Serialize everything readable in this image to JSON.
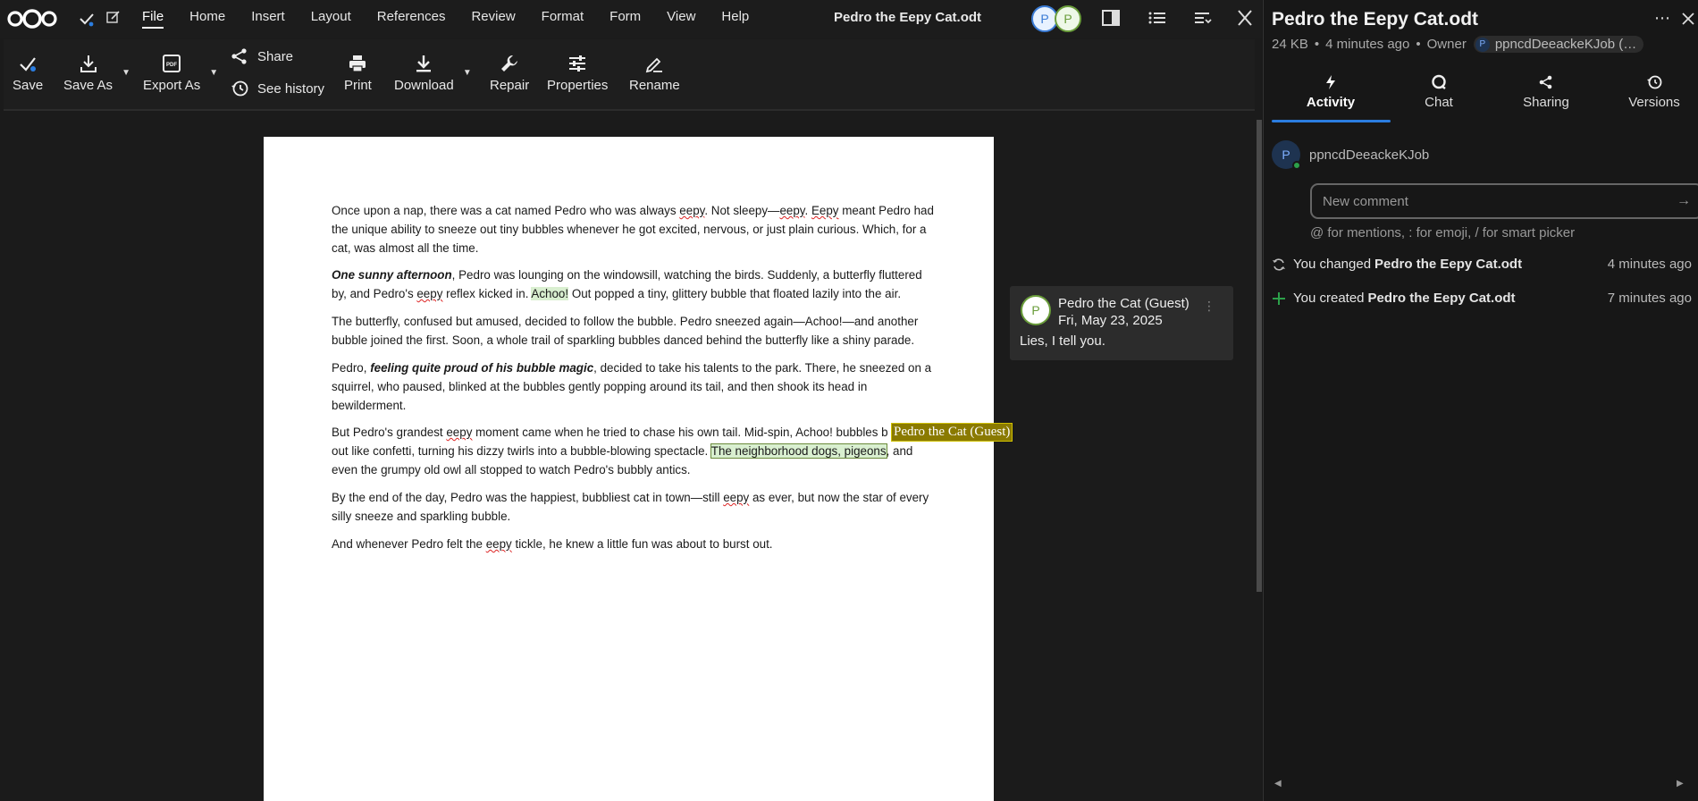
{
  "menubar": {
    "menus": [
      "File",
      "Home",
      "Insert",
      "Layout",
      "References",
      "Review",
      "Format",
      "Form",
      "View",
      "Help"
    ],
    "active_menu": "File",
    "doc_title": "Pedro the Eepy Cat.odt",
    "avatars": [
      "P",
      "P"
    ]
  },
  "toolbar": {
    "save": "Save",
    "save_as": "Save As",
    "export_as": "Export As",
    "share": "Share",
    "see_history": "See history",
    "print": "Print",
    "download": "Download",
    "repair": "Repair",
    "properties": "Properties",
    "rename": "Rename"
  },
  "document": {
    "p1_a": "Once upon a nap, there was a cat named Pedro who was always ",
    "p1_eepy1": "eepy",
    "p1_b": ". Not sleepy—",
    "p1_eepy2": "eepy",
    "p1_c": ". ",
    "p1_eepy3": "Eepy",
    "p1_d": " meant Pedro had the unique ability to sneeze out tiny bubbles whenever he got excited, nervous, or just plain curious. Which, for a cat, was almost all the time.",
    "p2_bold": "One sunny afternoon",
    "p2_a": ", Pedro was lounging on the windowsill, watching the birds. Suddenly, a butterfly fluttered by, and Pedro's ",
    "p2_eepy": "eepy",
    "p2_b": " reflex kicked in. ",
    "p2_achoo": "Achoo!",
    "p2_c": " Out popped a tiny, glittery bubble that floated lazily into the air.",
    "p3": "The butterfly, confused but amused, decided to follow the bubble. Pedro sneezed again—Achoo!—and another bubble joined the first. Soon, a whole trail of sparkling bubbles danced behind the butterfly like a shiny parade.",
    "p4_a": "Pedro, ",
    "p4_bold": "feeling quite proud of his bubble magic",
    "p4_b": ", decided to take his talents to the park. There, he sneezed on a squirrel, who paused, blinked at the bubbles gently popping around its tail, and then shook its head in bewilderment.",
    "p5_a": "But Pedro's grandest ",
    "p5_eepy": "eepy",
    "p5_b": " moment came when he tried to chase his own tail. Mid-spin, Achoo! bubbles b",
    "p5_c": "out like confetti, turning his dizzy twirls into a bubble-blowing spectacle. ",
    "p5_hl": "The neighborhood dogs, pigeons",
    "p5_d": ", and even the grumpy old owl all stopped to watch Pedro's bubbly antics.",
    "p6_a": "By the end of the day, Pedro was the happiest, bubbliest cat in town—still ",
    "p6_eepy": "eepy",
    "p6_b": " as ever, but now the star of every silly sneeze and sparkling bubble.",
    "p7_a": "And whenever Pedro felt the ",
    "p7_eepy": "eepy",
    "p7_b": " tickle, he knew a little fun was about to burst out.",
    "cursor_label": "Pedro the Cat (Guest)"
  },
  "comment": {
    "avatar": "P",
    "author": "Pedro the Cat (Guest)",
    "date": "Fri, May 23, 2025",
    "text": "Lies, I tell you."
  },
  "sidebar": {
    "title": "Pedro the Eepy Cat.odt",
    "size": "24 KB",
    "modified": "4 minutes ago",
    "owner_label": "Owner",
    "owner_avatar": "P",
    "owner_name": "ppncdDeeackeKJob (…",
    "tabs": [
      "Activity",
      "Chat",
      "Sharing",
      "Versions"
    ],
    "user_avatar": "P",
    "user_name": "ppncdDeeackeKJob",
    "comment_placeholder": "New comment",
    "hint": "@ for mentions, : for emoji, / for smart picker",
    "activities": [
      {
        "prefix": "You changed",
        "file": "Pedro the Eepy Cat.odt",
        "time": "4 minutes ago"
      },
      {
        "prefix": "You created",
        "file": "Pedro the Eepy Cat.odt",
        "time": "7 minutes ago"
      }
    ]
  },
  "colors": {
    "accent": "#2b7de0",
    "background": "#1b1b1b",
    "highlight": "#d9efd0",
    "cursor_tag": "#8a7a00"
  }
}
